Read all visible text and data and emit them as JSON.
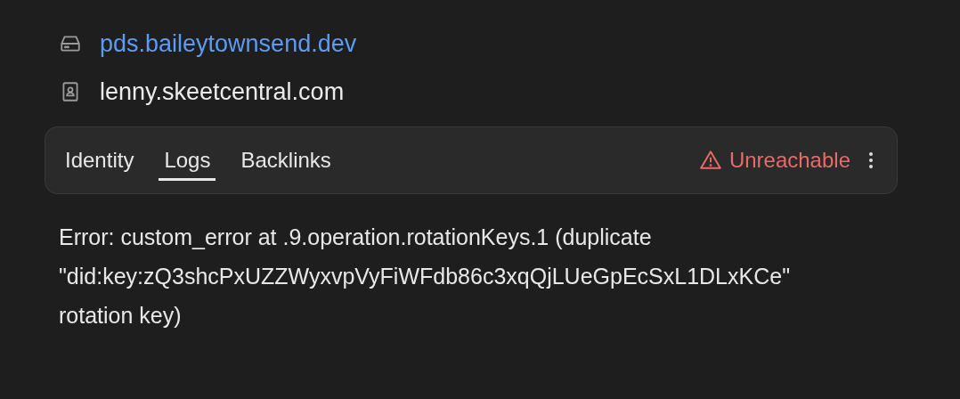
{
  "host": {
    "text": "pds.baileytownsend.dev"
  },
  "handle": {
    "text": "lenny.skeetcentral.com"
  },
  "tabs": [
    {
      "label": "Identity",
      "selected": false
    },
    {
      "label": "Logs",
      "selected": true
    },
    {
      "label": "Backlinks",
      "selected": false
    }
  ],
  "status": {
    "label": "Unreachable",
    "kind": "error"
  },
  "error": "Error: custom_error at .9.operation.rotationKeys.1 (duplicate \"did:key:zQ3shcPxUZZWyxvpVyFiWFdb86c3xqQjLUeGpEcSxL1DLxKCe\" rotation key)"
}
